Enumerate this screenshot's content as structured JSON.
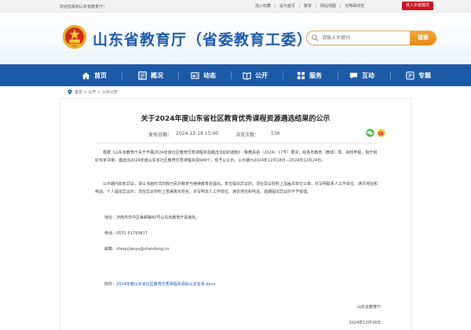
{
  "topbar": {
    "welcome": "欢迎您来到山东省教育厅！",
    "links": [
      "加入收藏",
      "设为首页",
      "繁体",
      "网站地图",
      "无障碍浏览"
    ],
    "elder_mode": "进入长者模式"
  },
  "header": {
    "site_title": "山东省教育厅（省委教育工委）",
    "search_placeholder": "请输入关键词",
    "search_button": "搜索"
  },
  "nav": {
    "items": [
      "首页",
      "概况",
      "动态",
      "公开",
      "服务",
      "互动",
      "专题"
    ]
  },
  "breadcrumb": {
    "home": "首页",
    "sep1": " > ",
    "level1": "公开",
    "sep2": " > ",
    "level2": "公示公告"
  },
  "article": {
    "title": "关于2024年度山东省社区教育优秀课程资源遴选结果的公示",
    "publish_label": "发布日期：",
    "publish_date": "2024-12-18 15:40",
    "views_label": "浏览次数：",
    "views": "536",
    "paragraph1": "根据《山东省教育厅关于开展2024年度社区教育优秀课程资源遴选活动的通知》（鲁教民函〔2024〕17号）要求，经各市教育（教体）局、高校申报，我厅组织专家评审，遴选出2024年度山东省社区教育优秀课程资源949个，现予以公示。公示期为2024年12月18日—2024年12月24日。",
    "paragraph2": "公示期内如有异议，请以书面形式向我厅民办教育与继续教育处提出。单位提出异议的，须在异议材料上加盖本单位公章，并写明联系人工作单位、通讯地址和电话。个人提出异议的，须在异议材料上签署真实姓名，并写明本人工作单位、通讯地址和电话。逾期提出异议的不予受理。",
    "address": "地址：济南市市中区舜耕路60号山东省教育厅民继处。",
    "phone": "电话：0531-51793817",
    "email": "邮箱：shequjiaoyu@shandong.cn",
    "attachment_label": "附件：",
    "attachment_name": "2024年度山东省社区教育优秀课程资源拟认定名单.docx",
    "signature_org": "山东省教育厅",
    "signature_date": "2024年12月18日"
  },
  "colors": {
    "brand_blue": "#1d5aa6",
    "accent_orange": "#e58a16",
    "elder_red": "#c8161e"
  },
  "icons": {
    "emblem": "national-emblem-icon",
    "search": "search-icon",
    "nav": [
      "home-icon",
      "overview-icon",
      "news-icon",
      "book-icon",
      "service-icon",
      "chat-icon",
      "topic-icon"
    ],
    "share": [
      "wechat-share-icon",
      "weibo-share-icon"
    ],
    "location": "location-pin-icon"
  }
}
